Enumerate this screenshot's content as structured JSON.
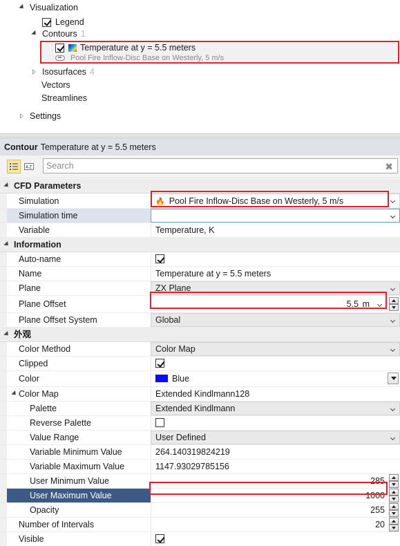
{
  "tree": {
    "visualization": "Visualization",
    "legend": "Legend",
    "contours": "Contours",
    "contours_count": "1",
    "contour_item_title": "Temperature at y = 5.5 meters",
    "contour_item_sub": "Pool Fire Inflow-Disc Base on Westerly, 5 m/s",
    "isosurfaces": "Isosurfaces",
    "isosurfaces_count": "4",
    "vectors": "Vectors",
    "streamlines": "Streamlines",
    "settings": "Settings"
  },
  "panel": {
    "header_bold": "Contour",
    "header_title": "Temperature at y = 5.5 meters",
    "search_placeholder": "Search",
    "search_clear": "✖"
  },
  "props": {
    "cat_cfd": "CFD Parameters",
    "simulation_label": "Simulation",
    "simulation_value": "Pool Fire Inflow-Disc Base on Westerly, 5 m/s",
    "simtime_label": "Simulation time",
    "simtime_value": "",
    "variable_label": "Variable",
    "variable_value": "Temperature, K",
    "cat_info": "Information",
    "autoname_label": "Auto-name",
    "autoname_checked": true,
    "name_label": "Name",
    "name_value": "Temperature at y = 5.5 meters",
    "plane_label": "Plane",
    "plane_value": "ZX Plane",
    "offset_label": "Plane Offset",
    "offset_value": "5.5",
    "offset_unit": "m",
    "offset_sys_label": "Plane Offset System",
    "offset_sys_value": "Global",
    "cat_appearance": "外观",
    "color_method_label": "Color Method",
    "color_method_value": "Color Map",
    "clipped_label": "Clipped",
    "clipped_checked": true,
    "color_label": "Color",
    "color_value": "Blue",
    "color_hex": "#0a0aff",
    "colormap_label": "Color Map",
    "colormap_value": "Extended Kindlmann128",
    "palette_label": "Palette",
    "palette_value": "Extended Kindlmann",
    "reverse_label": "Reverse Palette",
    "reverse_checked": false,
    "value_range_label": "Value Range",
    "value_range_value": "User Defined",
    "var_min_label": "Variable Minimum Value",
    "var_min_value": "264.140319824219",
    "var_max_label": "Variable Maximum Value",
    "var_max_value": "1147.93029785156",
    "user_min_label": "User Minimum Value",
    "user_min_value": "285",
    "user_max_label": "User Maximum Value",
    "user_max_value": "1000",
    "opacity_label": "Opacity",
    "opacity_value": "255",
    "intervals_label": "Number of Intervals",
    "intervals_value": "20",
    "visible_label": "Visible",
    "visible_checked": true
  },
  "colors": {
    "highlight_red": "#d9232e",
    "selected_row": "#3d5a86",
    "header_bg": "#dfe3e8"
  }
}
